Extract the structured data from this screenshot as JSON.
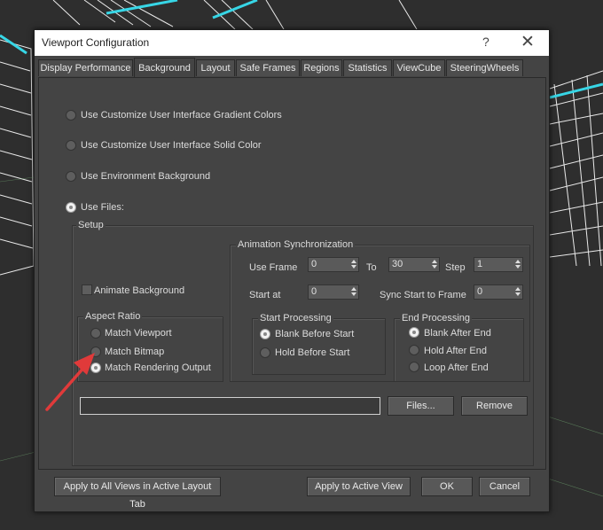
{
  "window": {
    "title": "Viewport Configuration",
    "help": "?",
    "close": "✕"
  },
  "tabs": [
    {
      "label": "Display Performance"
    },
    {
      "label": "Background"
    },
    {
      "label": "Layout"
    },
    {
      "label": "Safe Frames"
    },
    {
      "label": "Regions"
    },
    {
      "label": "Statistics"
    },
    {
      "label": "ViewCube"
    },
    {
      "label": "SteeringWheels"
    }
  ],
  "active_tab": "Background",
  "background_options": [
    {
      "label": "Use Customize User Interface Gradient Colors",
      "selected": false
    },
    {
      "label": "Use Customize User Interface Solid Color",
      "selected": false
    },
    {
      "label": "Use Environment Background",
      "selected": false
    },
    {
      "label": "Use Files:",
      "selected": true
    }
  ],
  "setup": {
    "title": "Setup",
    "animate_background": {
      "label": "Animate Background",
      "checked": false
    },
    "aspect_ratio": {
      "title": "Aspect Ratio",
      "options": [
        {
          "label": "Match Viewport",
          "selected": false
        },
        {
          "label": "Match Bitmap",
          "selected": false
        },
        {
          "label": "Match Rendering Output",
          "selected": true
        }
      ]
    },
    "animation_sync": {
      "title": "Animation Synchronization",
      "use_frame_label": "Use Frame",
      "use_frame_value": "0",
      "to_label": "To",
      "to_value": "30",
      "step_label": "Step",
      "step_value": "1",
      "start_at_label": "Start at",
      "start_at_value": "0",
      "sync_start_label": "Sync Start to Frame",
      "sync_start_value": "0",
      "start_processing": {
        "title": "Start Processing",
        "options": [
          {
            "label": "Blank Before Start",
            "selected": true
          },
          {
            "label": "Hold Before Start",
            "selected": false
          }
        ]
      },
      "end_processing": {
        "title": "End Processing",
        "options": [
          {
            "label": "Blank After End",
            "selected": true
          },
          {
            "label": "Hold After End",
            "selected": false
          },
          {
            "label": "Loop After End",
            "selected": false
          }
        ]
      }
    },
    "file_path": "",
    "files_button": "Files...",
    "remove_button": "Remove"
  },
  "footer": {
    "apply_all": "Apply to All Views in Active Layout Tab",
    "apply_active": "Apply to Active View",
    "ok": "OK",
    "cancel": "Cancel"
  },
  "colors": {
    "accent_arrow": "#e03a3a",
    "wire_cyan": "#37d6e6"
  }
}
